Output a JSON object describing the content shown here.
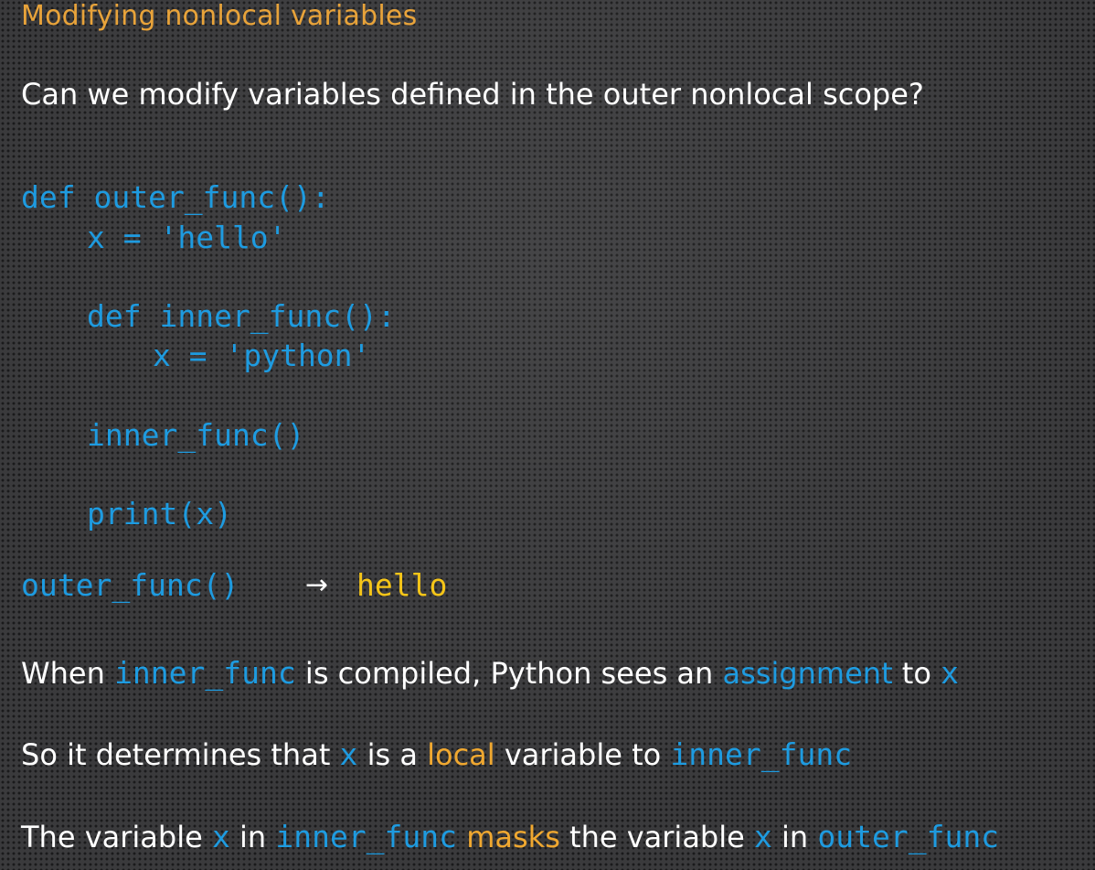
{
  "slide": {
    "title": "Modifying nonlocal variables",
    "question": "Can we modify variables defined in the outer nonlocal scope?",
    "code": {
      "line1": "def outer_func():",
      "line2": "x = 'hello'",
      "line3": "def inner_func():",
      "line4": "x = 'python'",
      "line5": "inner_func()",
      "line6": "print(x)",
      "call": "outer_func()",
      "arrow": "→",
      "output": "hello"
    },
    "explanation1": {
      "p1": "When ",
      "code1": "inner_func",
      "p2": " is compiled, Python sees an ",
      "hl1": "assignment",
      "p3": " to ",
      "code2": "x"
    },
    "explanation2": {
      "p1": "So it determines that ",
      "code1": "x",
      "p2": " is a ",
      "hl1": "local",
      "p3": " variable to ",
      "code2": "inner_func"
    },
    "explanation3": {
      "p1": "The variable ",
      "code1": "x",
      "p2": " in ",
      "code2": "inner_func",
      "p3": " ",
      "hl1": "masks",
      "p4": " the variable ",
      "code3": "x",
      "p5": " in ",
      "code4": "outer_func"
    }
  }
}
